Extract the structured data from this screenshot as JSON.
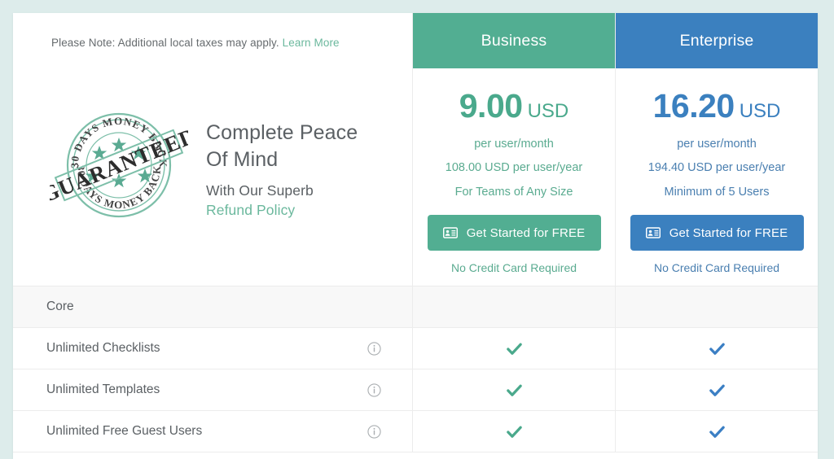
{
  "note": {
    "text": "Please Note: Additional local taxes may apply.",
    "link_label": "Learn More"
  },
  "guarantee": {
    "badge_icon": "money-back-guarantee-stamp",
    "badge_outer_text": "30 DAYS MONEY BACK",
    "badge_center_text": "GUARANTEED",
    "heading_line1": "Complete Peace",
    "heading_line2": "Of Mind",
    "subheading": "With Our Superb",
    "link_label": "Refund Policy"
  },
  "colors": {
    "business": "#52ae92",
    "business_text": "#4aa98c",
    "enterprise": "#3b80bf",
    "page_background": "#ddeceb",
    "muted_text": "#5b6064"
  },
  "plans": [
    {
      "key": "business",
      "name": "Business",
      "price_amount": "9.00",
      "currency": "USD",
      "period": "per user/month",
      "annual": "108.00  USD  per user/year",
      "eligibility": "For Teams of Any Size",
      "cta_label": "Get Started for FREE",
      "cta_icon": "id-card-icon",
      "cta_note": "No Credit Card Required"
    },
    {
      "key": "enterprise",
      "name": "Enterprise",
      "price_amount": "16.20",
      "currency": "USD",
      "period": "per user/month",
      "annual": "194.40  USD  per user/year",
      "eligibility": "Minimum of 5 Users",
      "cta_label": "Get Started for FREE",
      "cta_icon": "id-card-icon",
      "cta_note": "No Credit Card Required"
    }
  ],
  "feature_table": {
    "group_label": "Core",
    "rows": [
      {
        "label": "Unlimited Checklists",
        "info_icon": "info-icon",
        "business": "check",
        "enterprise": "check"
      },
      {
        "label": "Unlimited Templates",
        "info_icon": "info-icon",
        "business": "check",
        "enterprise": "check"
      },
      {
        "label": "Unlimited Free Guest Users",
        "info_icon": "info-icon",
        "business": "check",
        "enterprise": "check"
      }
    ]
  }
}
